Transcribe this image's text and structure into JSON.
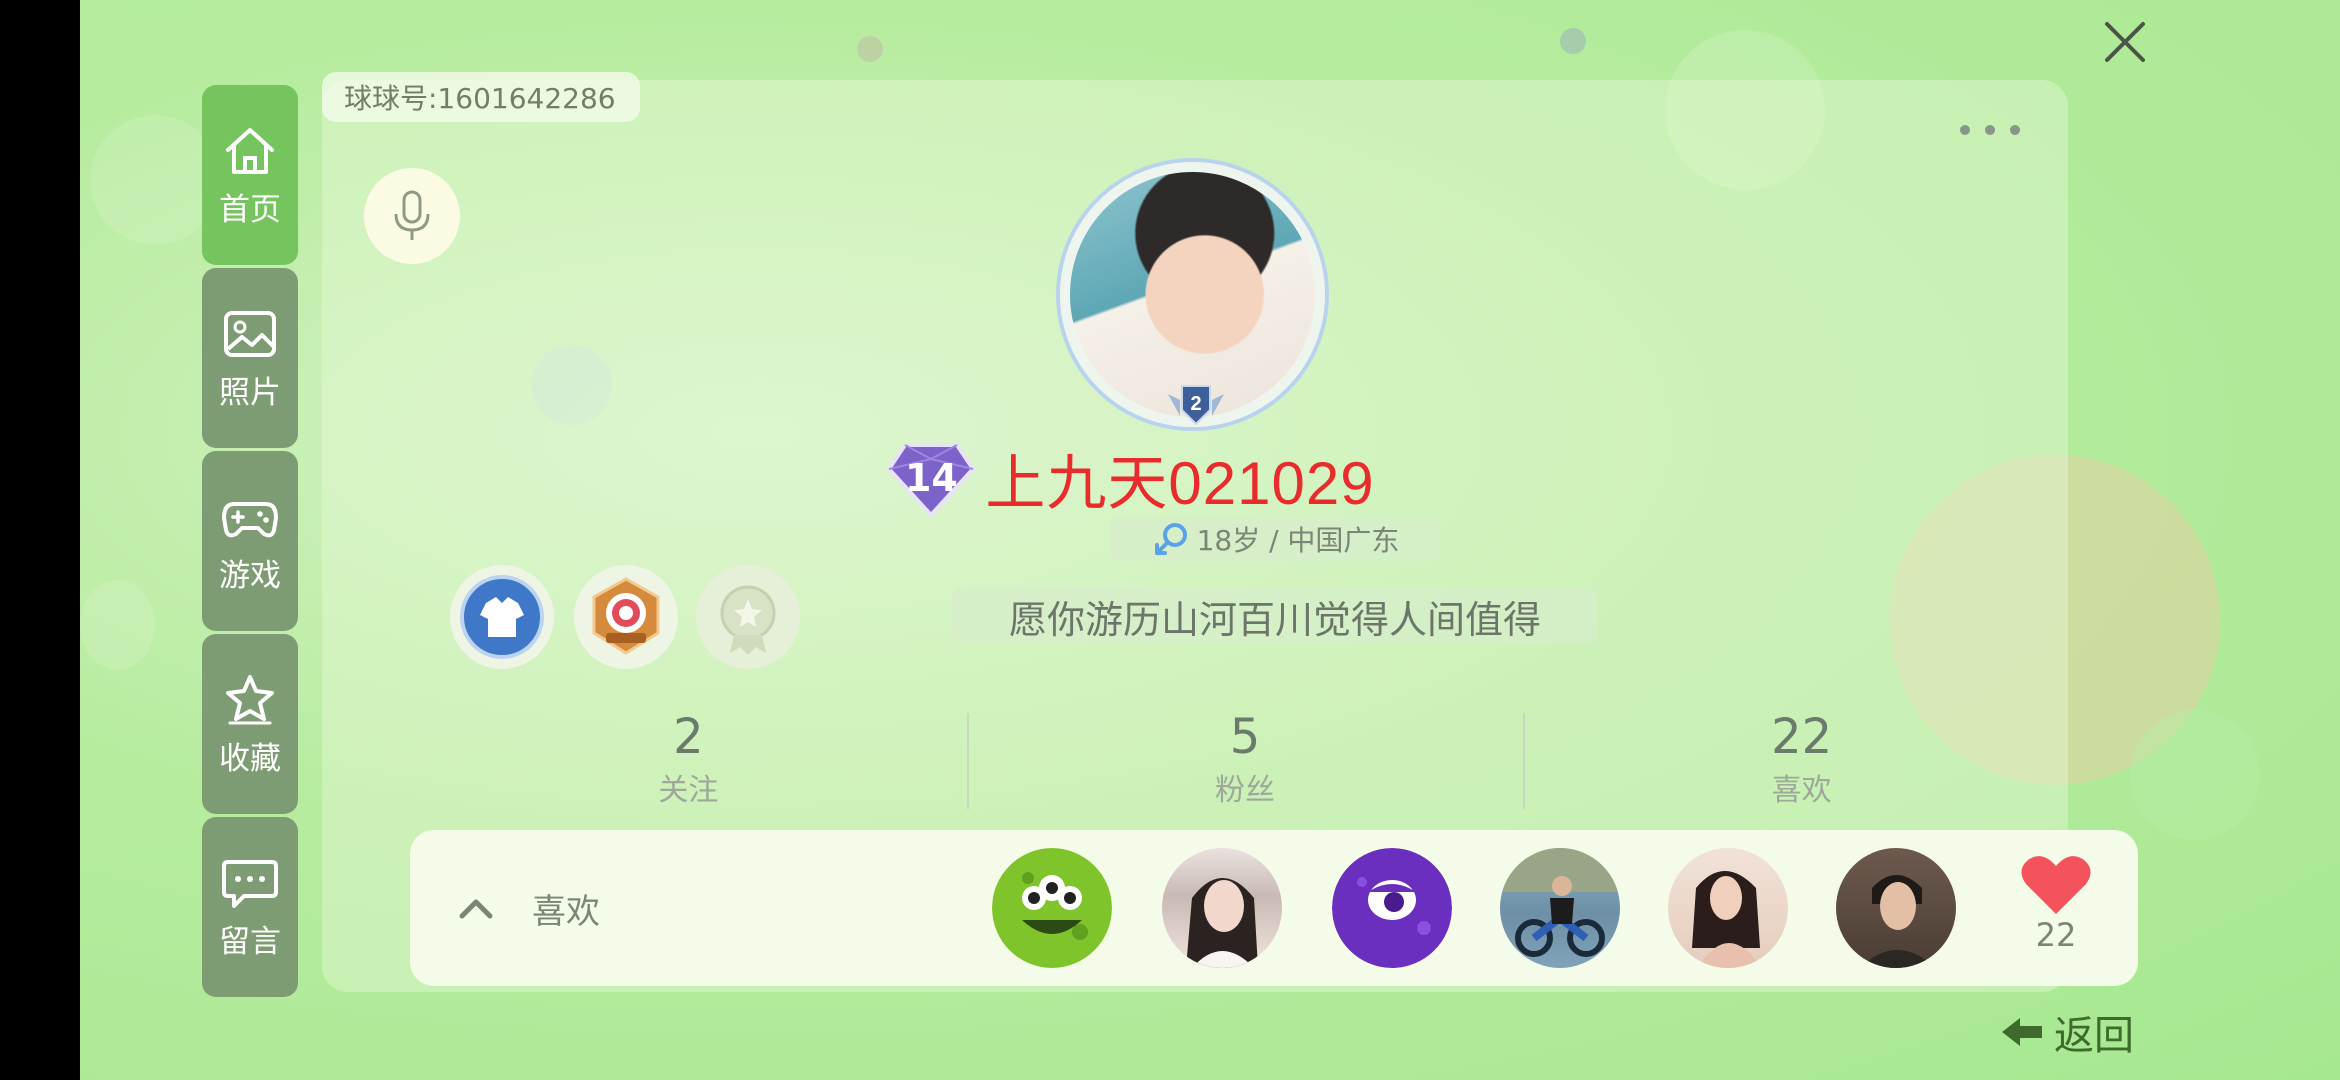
{
  "profile": {
    "uid_label": "球球号:1601642286",
    "username": "上九天021029",
    "level": "14",
    "rank_badge": "2",
    "info": "18岁 / 中国广东",
    "bio": "愿你游历山河百川觉得人间值得"
  },
  "nav": [
    {
      "label": "首页",
      "icon": "home-icon",
      "active": true
    },
    {
      "label": "照片",
      "icon": "photo-icon",
      "active": false
    },
    {
      "label": "游戏",
      "icon": "gamepad-icon",
      "active": false
    },
    {
      "label": "收藏",
      "icon": "star-icon",
      "active": false
    },
    {
      "label": "留言",
      "icon": "message-icon",
      "active": false
    }
  ],
  "stats": [
    {
      "value": "2",
      "label": "关注"
    },
    {
      "value": "5",
      "label": "粉丝"
    },
    {
      "value": "22",
      "label": "喜欢"
    }
  ],
  "likes": {
    "label": "喜欢",
    "count": "22"
  },
  "footer": {
    "back_label": "返回"
  },
  "colors": {
    "username": "#e82c2c",
    "nav_active": "#76c45e",
    "nav_inactive": "#7e9c73",
    "heart": "#f4525c"
  }
}
